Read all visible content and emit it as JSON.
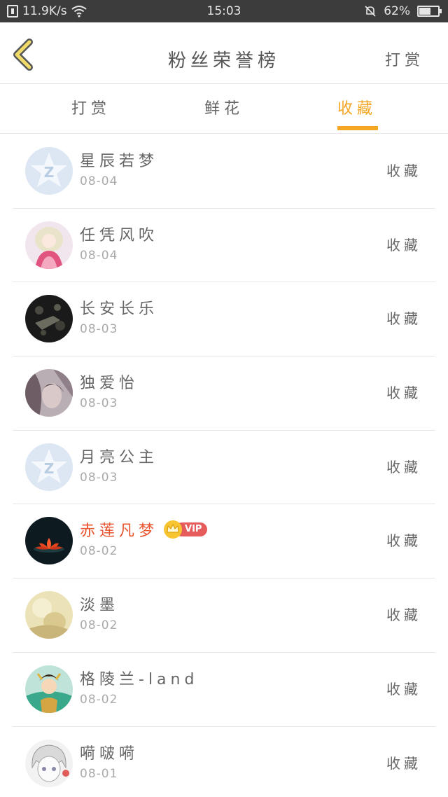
{
  "status_bar": {
    "speed": "11.9K/s",
    "time": "15:03",
    "battery": "62%",
    "battery_level": 0.62
  },
  "header": {
    "title": "粉丝荣誉榜",
    "action": "打赏"
  },
  "tabs": [
    {
      "label": "打赏"
    },
    {
      "label": "鲜花"
    },
    {
      "label": "收藏",
      "active": true
    }
  ],
  "colors": {
    "accent": "#f5a623",
    "vip_name": "#e8542c",
    "vip_badge": "#e65c5c"
  },
  "fans": [
    {
      "name": "星辰若梦",
      "date": "08-04",
      "action": "收藏",
      "avatar": "qq-default-icon"
    },
    {
      "name": "任凭风吹",
      "date": "08-04",
      "action": "收藏",
      "avatar": "anime-girl-avatar"
    },
    {
      "name": "长安长乐",
      "date": "08-03",
      "action": "收藏",
      "avatar": "dark-photo-avatar"
    },
    {
      "name": "独爱怡",
      "date": "08-03",
      "action": "收藏",
      "avatar": "portrait-avatar"
    },
    {
      "name": "月亮公主",
      "date": "08-03",
      "action": "收藏",
      "avatar": "qq-default-icon"
    },
    {
      "name": "赤莲凡梦",
      "date": "08-02",
      "action": "收藏",
      "avatar": "lotus-avatar",
      "vip": "VIP"
    },
    {
      "name": "淡墨",
      "date": "08-02",
      "action": "收藏",
      "avatar": "faded-photo-avatar"
    },
    {
      "name": "格陵兰-land",
      "date": "08-02",
      "action": "收藏",
      "avatar": "costume-avatar"
    },
    {
      "name": "嗬啵嗬",
      "date": "08-01",
      "action": "收藏",
      "avatar": "anime-sketch-avatar"
    }
  ]
}
